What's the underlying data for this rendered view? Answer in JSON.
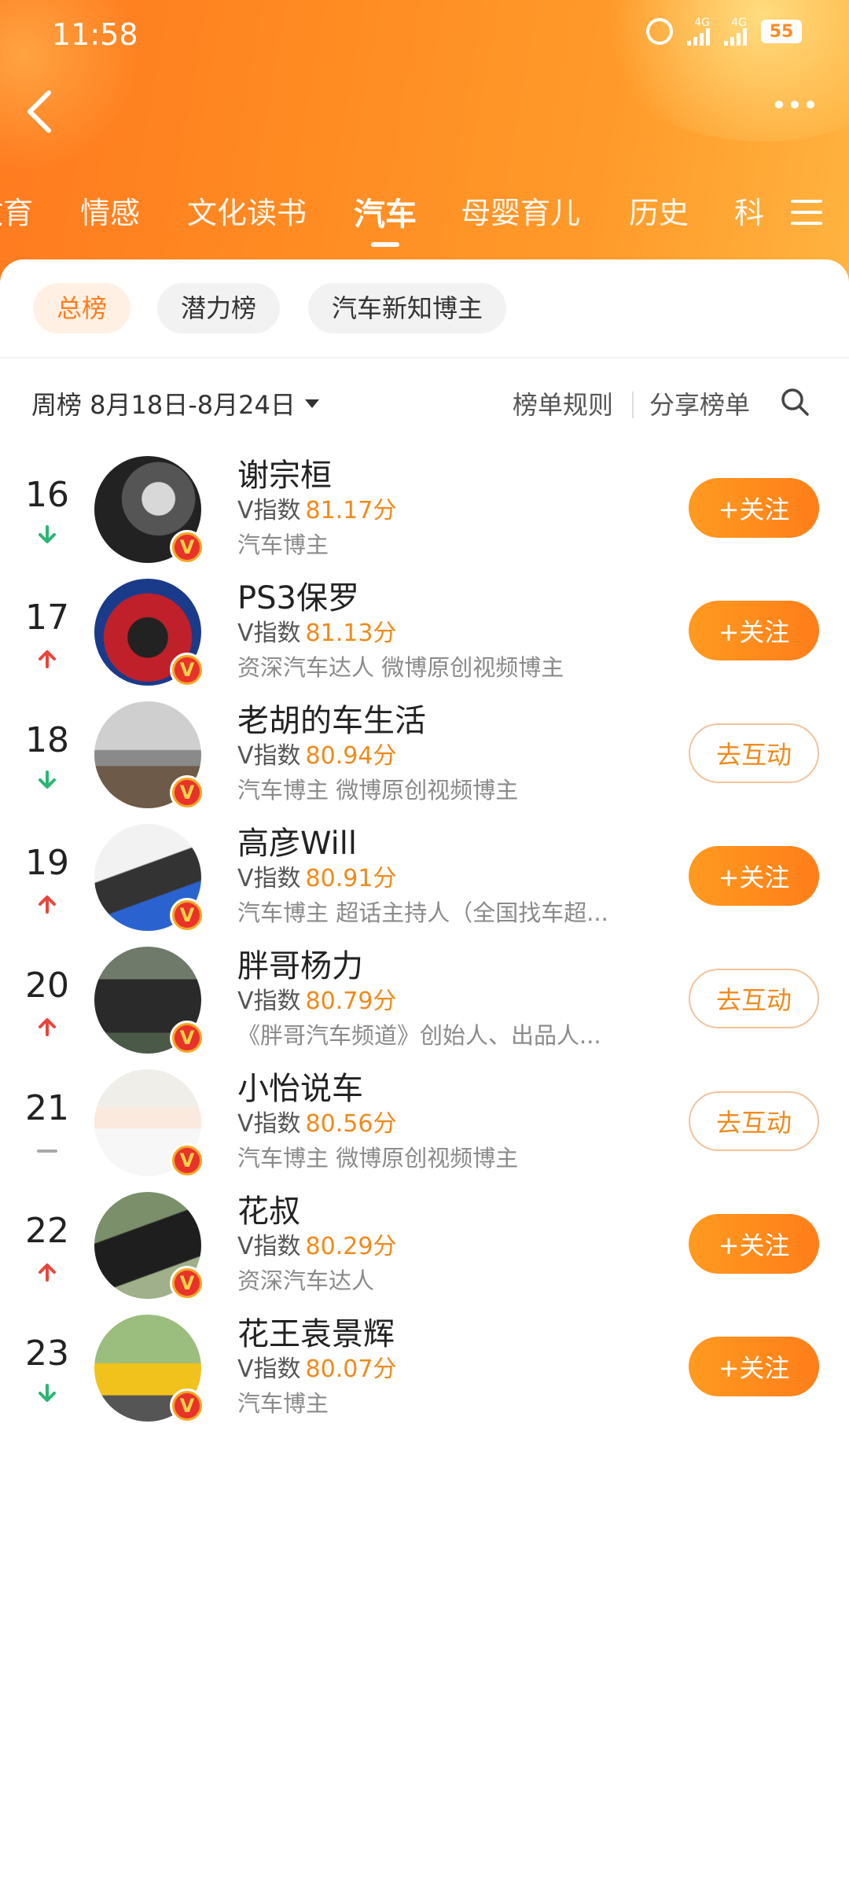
{
  "status_bar": {
    "time": "11:58",
    "signal1": "4G",
    "signal2": "4G",
    "battery": "55"
  },
  "tabs": [
    {
      "label": "教育"
    },
    {
      "label": "情感"
    },
    {
      "label": "文化读书"
    },
    {
      "label": "汽车"
    },
    {
      "label": "母婴育儿"
    },
    {
      "label": "历史"
    },
    {
      "label": "科"
    }
  ],
  "active_tab": "汽车",
  "chips": [
    "总榜",
    "潜力榜",
    "汽车新知博主"
  ],
  "toolbar": {
    "week_label": "周榜 8月18日-8月24日",
    "rules": "榜单规则",
    "share": "分享榜单"
  },
  "ranking": [
    {
      "rank": "16",
      "trend": "down",
      "name": "谢宗桓",
      "vindex_label": "V指数",
      "score": "81.17分",
      "desc": "汽车博主",
      "action": "+关注",
      "action_type": "follow"
    },
    {
      "rank": "17",
      "trend": "up",
      "name": "PS3保罗",
      "vindex_label": "V指数",
      "score": "81.13分",
      "desc": "资深汽车达人 微博原创视频博主",
      "action": "+关注",
      "action_type": "follow"
    },
    {
      "rank": "18",
      "trend": "down",
      "name": "老胡的车生活",
      "vindex_label": "V指数",
      "score": "80.94分",
      "desc": "汽车博主 微博原创视频博主",
      "action": "去互动",
      "action_type": "interact"
    },
    {
      "rank": "19",
      "trend": "up",
      "name": "高彦Will",
      "vindex_label": "V指数",
      "score": "80.91分",
      "desc": "汽车博主 超话主持人（全国找车超...",
      "action": "+关注",
      "action_type": "follow"
    },
    {
      "rank": "20",
      "trend": "up",
      "name": "胖哥杨力",
      "vindex_label": "V指数",
      "score": "80.79分",
      "desc": "《胖哥汽车频道》创始人、出品人...",
      "action": "去互动",
      "action_type": "interact"
    },
    {
      "rank": "21",
      "trend": "same",
      "name": "小怡说车",
      "vindex_label": "V指数",
      "score": "80.56分",
      "desc": "汽车博主 微博原创视频博主",
      "action": "去互动",
      "action_type": "interact"
    },
    {
      "rank": "22",
      "trend": "up",
      "name": "花叔",
      "vindex_label": "V指数",
      "score": "80.29分",
      "desc": "资深汽车达人",
      "action": "+关注",
      "action_type": "follow"
    },
    {
      "rank": "23",
      "trend": "down",
      "name": "花王袁景辉",
      "vindex_label": "V指数",
      "score": "80.07分",
      "desc": "汽车博主",
      "action": "+关注",
      "action_type": "follow"
    }
  ],
  "badge_letter": "V",
  "colors": {
    "accent": "#ff8a22",
    "score": "#f08a1a",
    "up": "#e8453c",
    "down": "#2bb673"
  }
}
